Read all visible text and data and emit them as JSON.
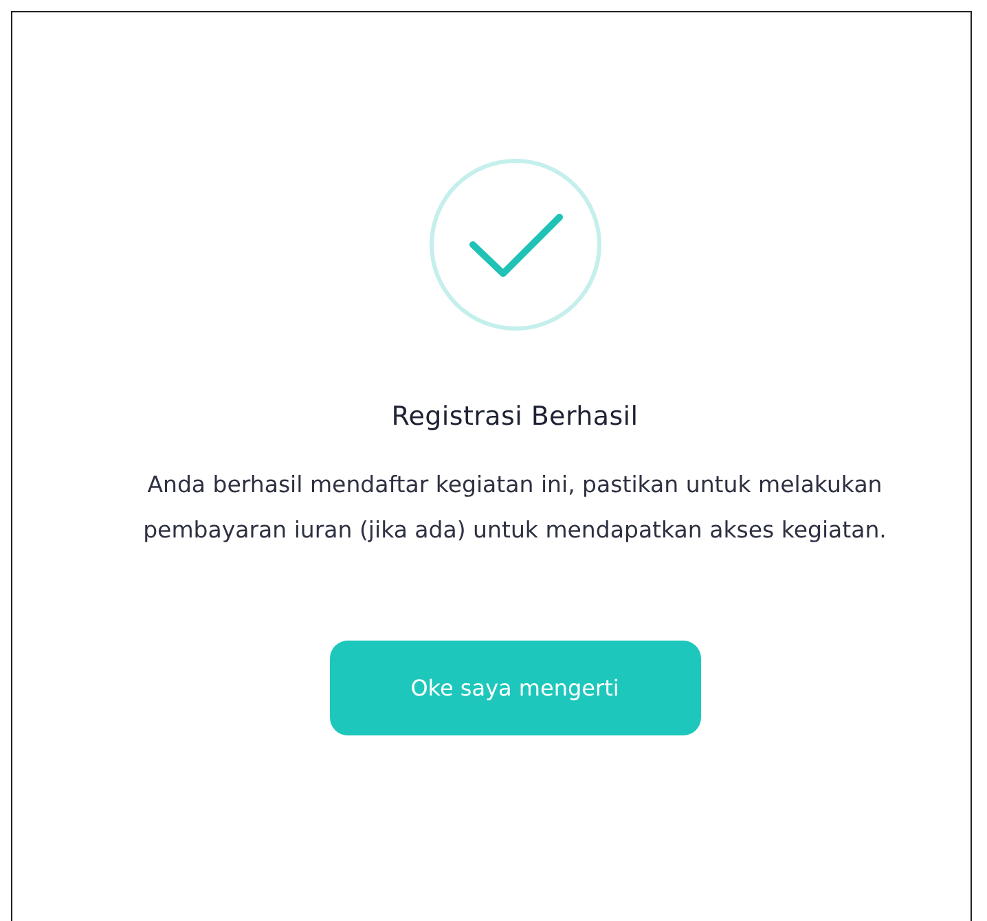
{
  "dialog": {
    "title": "Registrasi Berhasil",
    "message": "Anda berhasil mendaftar kegiatan ini, pastikan untuk melakukan pembayaran iuran (jika ada) untuk mendapatkan akses kegiatan.",
    "button": "Oke saya mengerti"
  }
}
